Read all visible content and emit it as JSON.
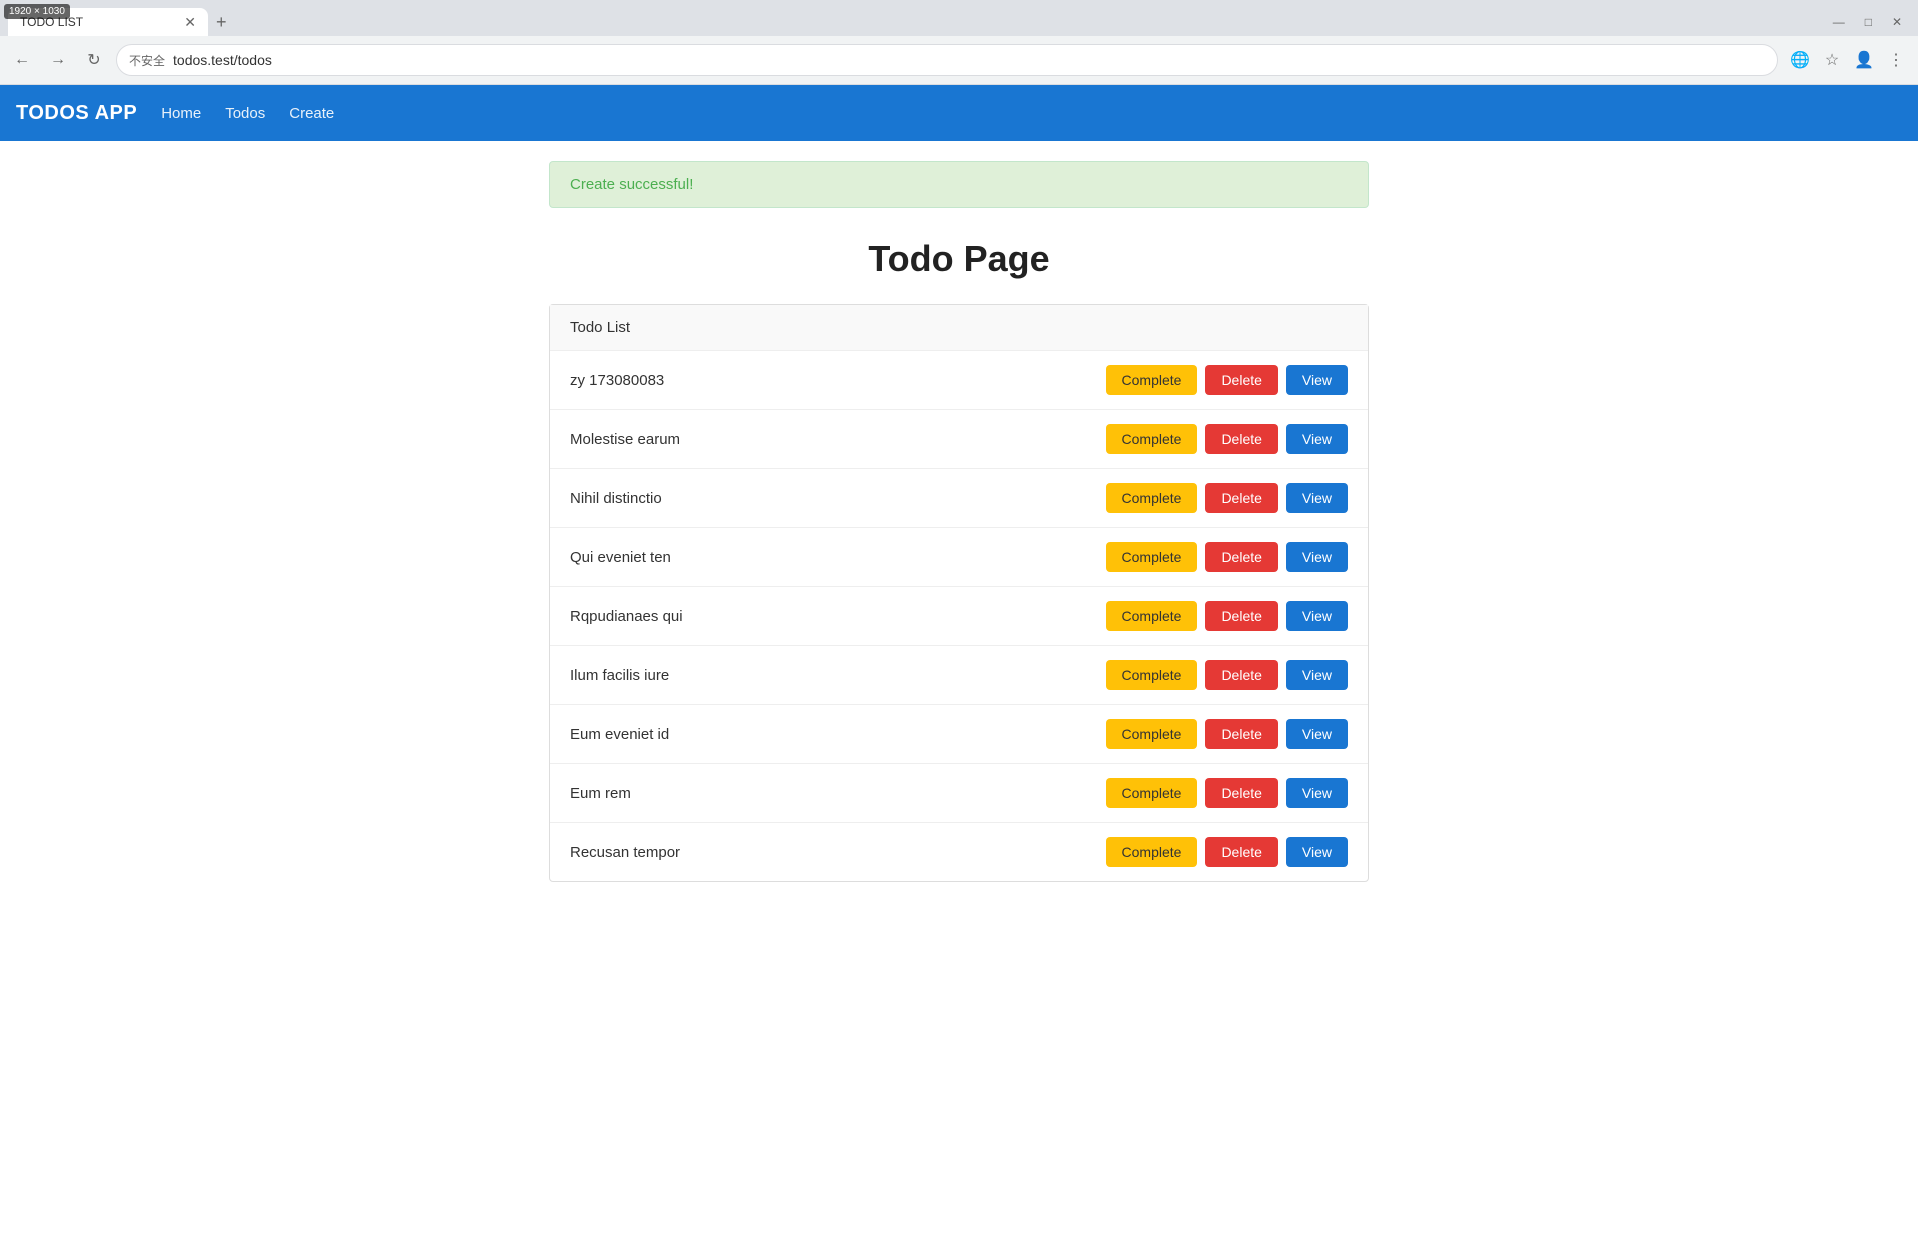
{
  "resolution": "1920 × 1030",
  "browser": {
    "tab_title": "TODO LIST",
    "new_tab_label": "+",
    "address": "todos.test/todos",
    "insecure_label": "不安全",
    "nav": {
      "back": "←",
      "forward": "→",
      "reload": "↻"
    },
    "window_controls": {
      "minimize": "—",
      "maximize": "□",
      "close": "✕"
    }
  },
  "app": {
    "brand": "TODOS APP",
    "nav_links": [
      "Home",
      "Todos",
      "Create"
    ]
  },
  "alert": {
    "message": "Create successful!"
  },
  "page": {
    "title": "Todo Page"
  },
  "todo_list": {
    "header": "Todo List",
    "items": [
      {
        "id": 1,
        "title": "zy 173080083"
      },
      {
        "id": 2,
        "title": "Molestise earum"
      },
      {
        "id": 3,
        "title": "Nihil distinctio"
      },
      {
        "id": 4,
        "title": "Qui eveniet ten"
      },
      {
        "id": 5,
        "title": "Rqpudianaes qui"
      },
      {
        "id": 6,
        "title": "Ilum facilis iure"
      },
      {
        "id": 7,
        "title": "Eum eveniet id"
      },
      {
        "id": 8,
        "title": "Eum rem"
      },
      {
        "id": 9,
        "title": "Recusan tempor"
      }
    ],
    "buttons": {
      "complete": "Complete",
      "delete": "Delete",
      "view": "View"
    }
  }
}
